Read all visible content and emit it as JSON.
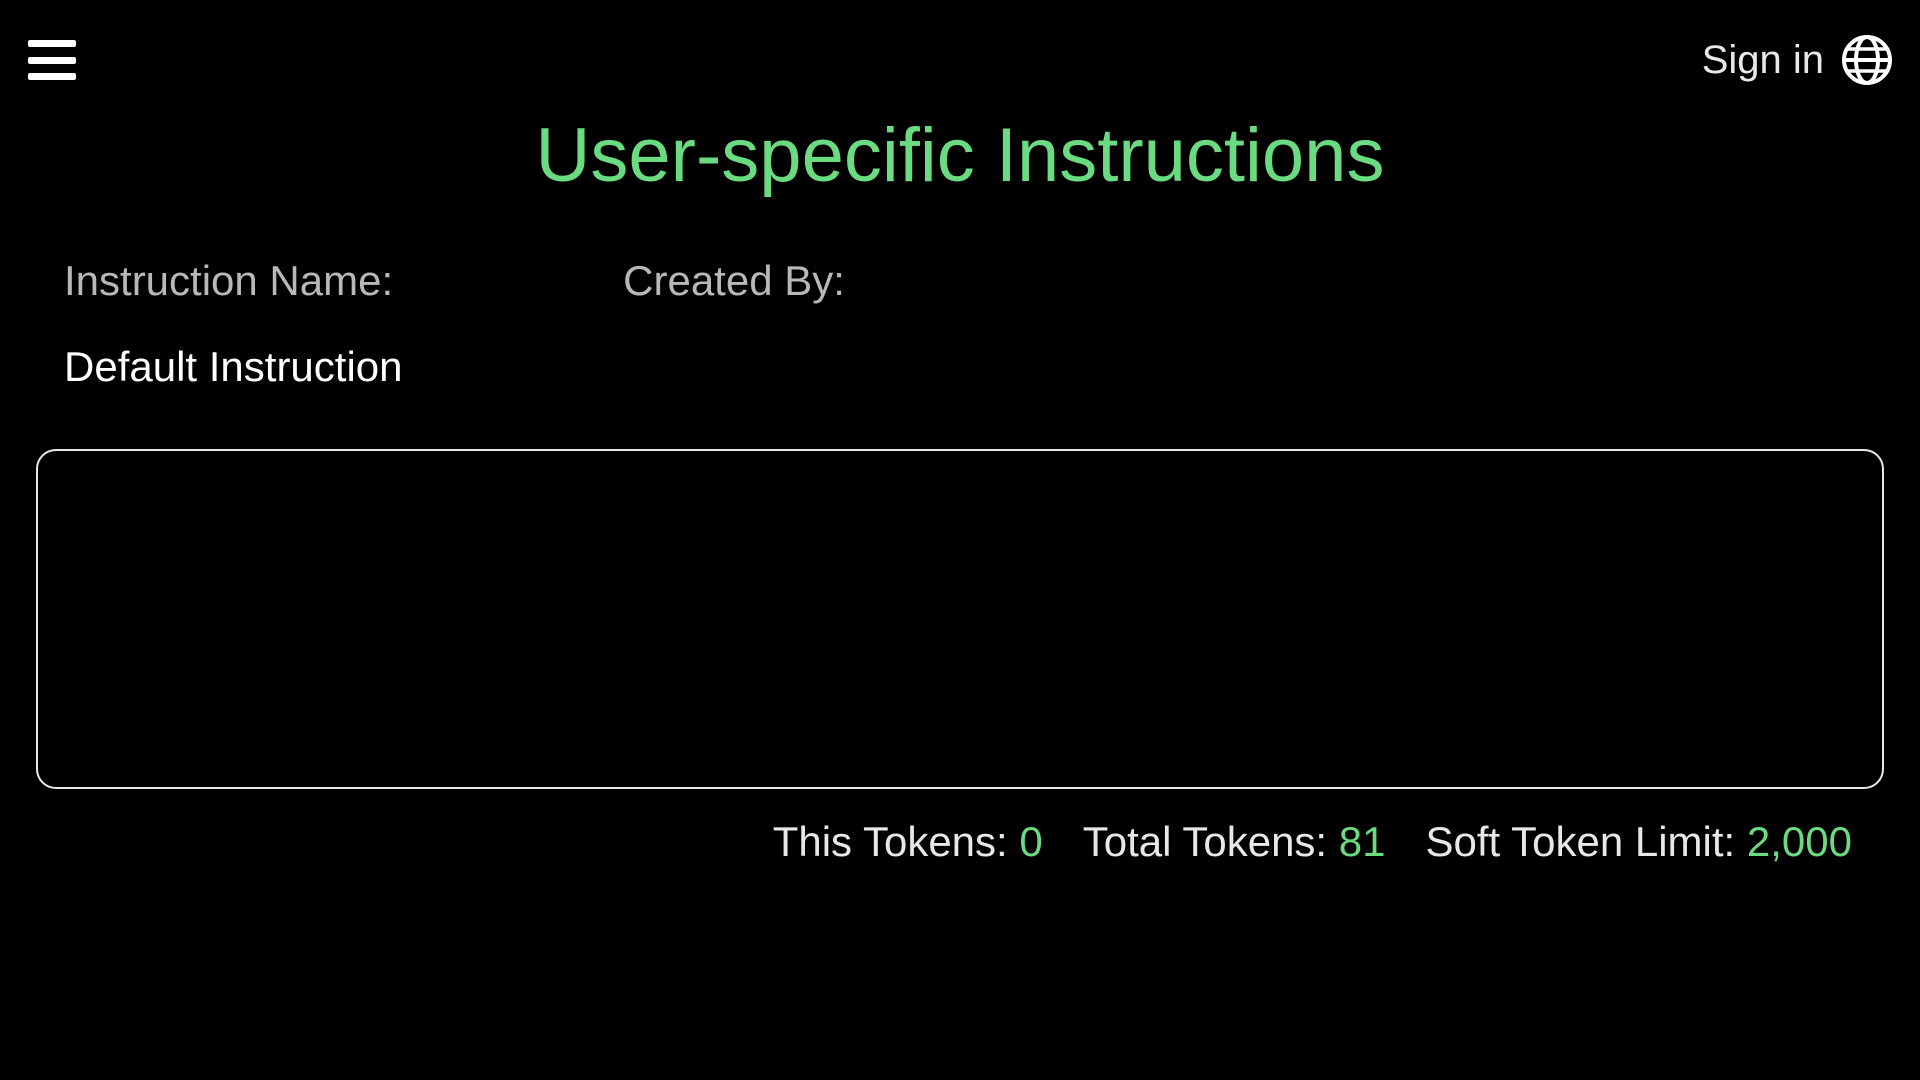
{
  "header": {
    "sign_in_label": "Sign in"
  },
  "page": {
    "title": "User-specific Instructions"
  },
  "info": {
    "instruction_name_label": "Instruction Name:",
    "created_by_label": "Created By:",
    "instruction_name_value": "Default Instruction",
    "created_by_value": ""
  },
  "textarea": {
    "value": "",
    "placeholder": ""
  },
  "tokens": {
    "this_label": "This Tokens: ",
    "this_value": "0",
    "total_label": "Total Tokens: ",
    "total_value": "81",
    "limit_label": "Soft Token Limit: ",
    "limit_value": "2,000"
  },
  "colors": {
    "accent": "#6bdb82",
    "background": "#000000",
    "text": "#ffffff",
    "muted": "#b8b8b8"
  }
}
